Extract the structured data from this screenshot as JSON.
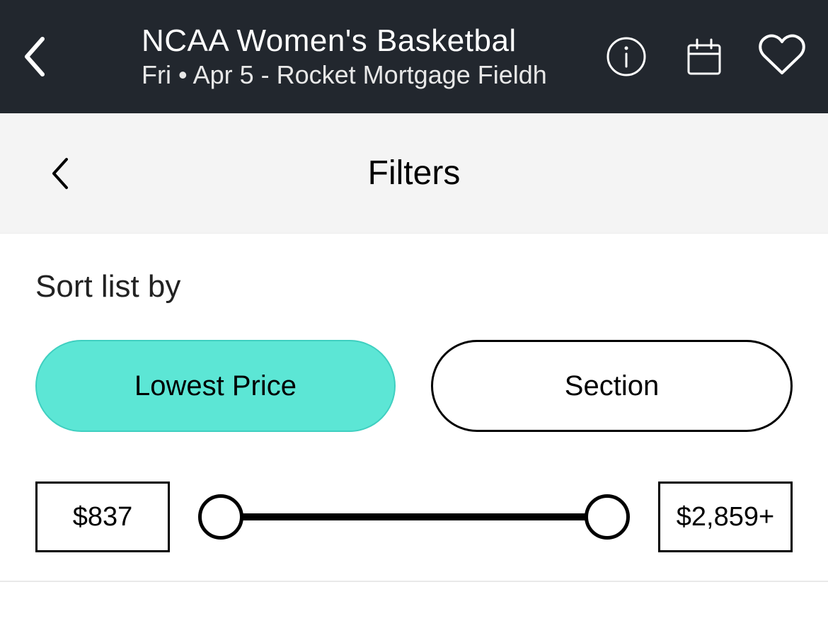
{
  "header": {
    "title": "NCAA Women's Basketbal",
    "subtitle": "Fri • Apr 5 - Rocket Mortgage Fieldh"
  },
  "subheader": {
    "title": "Filters"
  },
  "sort": {
    "label": "Sort list by",
    "options": {
      "lowest_price": "Lowest Price",
      "section": "Section"
    },
    "selected": "lowest_price"
  },
  "price_range": {
    "min_display": "$837",
    "max_display": "$2,859+"
  }
}
